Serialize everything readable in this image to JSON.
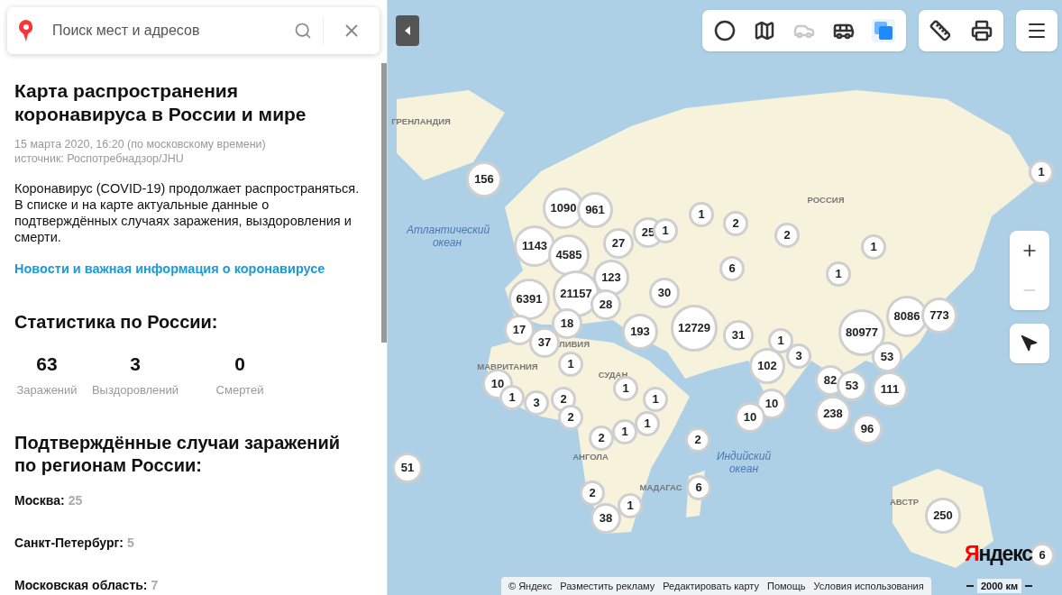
{
  "search": {
    "placeholder": "Поиск мест и адресов"
  },
  "panel": {
    "title": "Карта распространения коронавируса в России и мире",
    "date": "15 марта 2020, 16:20 (по московскому времени)",
    "source": "источник: Роспотребнадзор/JHU",
    "description": "Коронавирус (COVID-19) продолжает распространяться. В списке и на карте актуальные данные о подтверждённых случаях заражения, выздоровления и смерти.",
    "link": "Новости и важная информация о коронавирусе",
    "stats_title": "Статистика по России:",
    "stats": [
      {
        "value": "63",
        "label": "Заражений"
      },
      {
        "value": "3",
        "label": "Выздоровлений"
      },
      {
        "value": "0",
        "label": "Смертей"
      }
    ],
    "regions_title": "Подтверждённые случаи заражений по регионам России:",
    "regions": [
      {
        "name": "Москва:",
        "count": "25"
      },
      {
        "name": "Санкт-Петербург:",
        "count": "5"
      },
      {
        "name": "Московская область:",
        "count": "7"
      }
    ]
  },
  "map": {
    "toolbar": [
      {
        "selected": false,
        "disabled": false
      },
      {
        "selected": false,
        "disabled": false
      },
      {
        "selected": false,
        "disabled": true
      },
      {
        "selected": false,
        "disabled": false
      },
      {
        "selected": true,
        "disabled": false
      }
    ],
    "zoom_out_disabled": true,
    "labels": [
      {
        "text": "ГРЕНЛАНДИЯ",
        "kind": "country"
      },
      {
        "text": "РОССИЯ",
        "kind": "country"
      },
      {
        "text": "Атлантический океан",
        "kind": "ocean"
      },
      {
        "text": "Индийский океан",
        "kind": "ocean"
      },
      {
        "text": "ЛИВИЯ",
        "kind": "country"
      },
      {
        "text": "МАВРИТАНИЯ",
        "kind": "country"
      },
      {
        "text": "СУДАН",
        "kind": "country"
      },
      {
        "text": "АНГОЛА",
        "kind": "country"
      },
      {
        "text": "МАДАГАС",
        "kind": "country"
      },
      {
        "text": "АВСТР",
        "kind": "country"
      }
    ],
    "clusters": [
      "156",
      "1090",
      "961",
      "1143",
      "4585",
      "27",
      "25",
      "1",
      "123",
      "6391",
      "21157",
      "28",
      "30",
      "18",
      "17",
      "37",
      "193",
      "12729",
      "31",
      "1",
      "10",
      "1",
      "3",
      "2",
      "1",
      "1",
      "2",
      "2",
      "1",
      "1",
      "1",
      "2",
      "2",
      "1",
      "6",
      "1",
      "1",
      "8086",
      "773",
      "80977",
      "53",
      "1",
      "3",
      "102",
      "82",
      "53",
      "111",
      "238",
      "96",
      "10",
      "10",
      "2",
      "6",
      "2",
      "1",
      "38",
      "250",
      "6",
      "51"
    ],
    "footer": {
      "copyright": "© Яндекс",
      "links": [
        "Разместить рекламу",
        "Редактировать карту",
        "Помощь",
        "Условия использования"
      ],
      "scale": "2000 км",
      "logo": "Яндекс"
    }
  }
}
